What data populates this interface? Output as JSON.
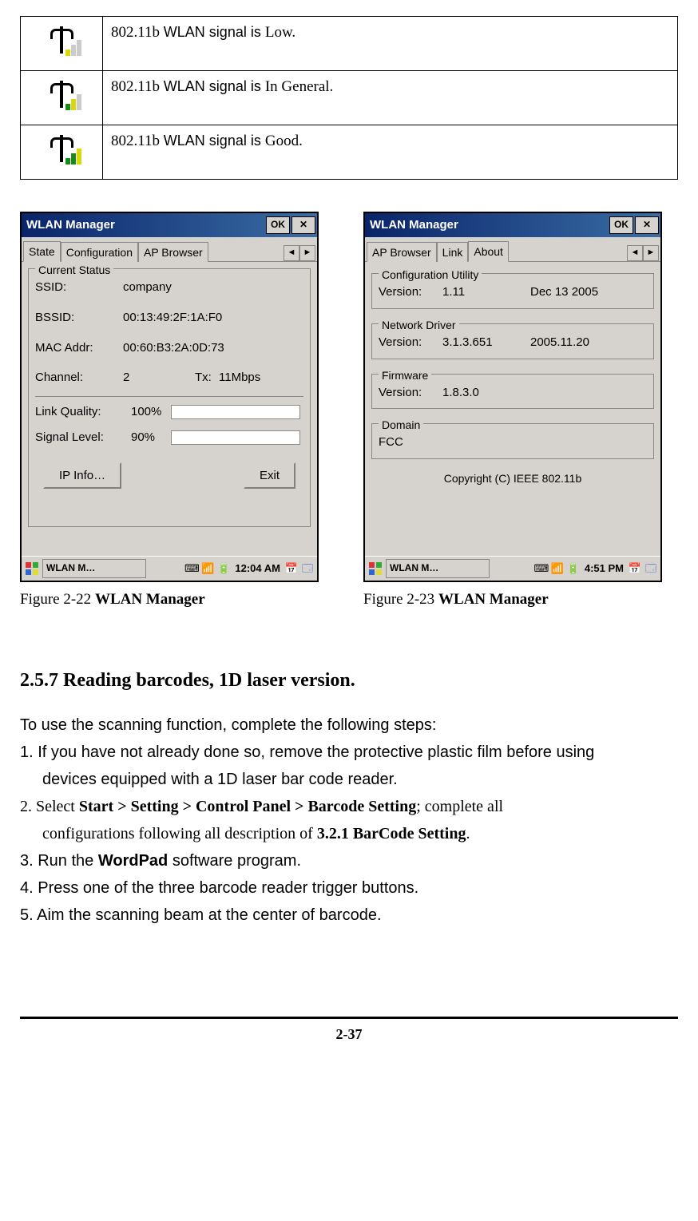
{
  "signal_table": {
    "rows": [
      {
        "prefix": "802.11b ",
        "mid": "WLAN signal is ",
        "suffix": "Low.",
        "bars_on": 1
      },
      {
        "prefix": "802.11b ",
        "mid": "WLAN signal is ",
        "suffix": "In General.",
        "bars_on": 2
      },
      {
        "prefix": "802.11b ",
        "mid": "WLAN signal is ",
        "suffix": "Good.",
        "bars_on": 3
      }
    ]
  },
  "left_window": {
    "title": "WLAN Manager",
    "ok": "OK",
    "close": "✕",
    "tabs": [
      "State",
      "Configuration",
      "AP Browser"
    ],
    "active_tab_index": 0,
    "group_legend": "Current Status",
    "fields": {
      "ssid_label": "SSID:",
      "ssid_value": "company",
      "bssid_label": "BSSID:",
      "bssid_value": "00:13:49:2F:1A:F0",
      "mac_label": "MAC Addr:",
      "mac_value": "00:60:B3:2A:0D:73",
      "channel_label": "Channel:",
      "channel_value": "2",
      "tx_label": "Tx:",
      "tx_value": "11Mbps",
      "linkq_label": "Link Quality:",
      "linkq_value": "100%",
      "linkq_percent": 100,
      "siglvl_label": "Signal Level:",
      "siglvl_value": "90%",
      "siglvl_percent": 90
    },
    "buttons": {
      "ipinfo": "IP Info…",
      "exit": "Exit"
    },
    "taskbar": {
      "task": "WLAN M…",
      "time": "12:04 AM"
    }
  },
  "right_window": {
    "title": "WLAN Manager",
    "ok": "OK",
    "close": "✕",
    "tabs": [
      "AP Browser",
      "Link",
      "About"
    ],
    "active_tab_index": 2,
    "groups": {
      "config_util": {
        "legend": "Configuration Utility",
        "version_label": "Version:",
        "version_value": "1.11",
        "date_value": "Dec 13 2005"
      },
      "net_driver": {
        "legend": "Network Driver",
        "version_label": "Version:",
        "version_value": "3.1.3.651",
        "date_value": "2005.11.20"
      },
      "firmware": {
        "legend": "Firmware",
        "version_label": "Version:",
        "version_value": "1.8.3.0"
      },
      "domain": {
        "legend": "Domain",
        "value": "FCC"
      }
    },
    "copyright": "Copyright (C)  IEEE  802.11b",
    "taskbar": {
      "task": "WLAN M…",
      "time": "4:51 PM"
    }
  },
  "captions": {
    "left_prefix": "Figure 2-22 ",
    "left_bold": "WLAN Manager",
    "right_prefix": "Figure 2-23 ",
    "right_bold": "WLAN Manager"
  },
  "section_heading": "2.5.7 Reading barcodes, 1D laser version.",
  "body": {
    "intro": "To use the scanning function, complete the following steps:",
    "step1a": "1. If you have not already done so, remove the protective plastic film before using",
    "step1b": "devices equipped with a 1D laser bar code reader.",
    "step2a_prefix": "2. ",
    "step2a_serif1": "Select ",
    "step2a_bold": "Start > Setting > Control Panel > Barcode Setting",
    "step2a_serif2": "; complete all",
    "step2b_serif1": "configurations following all description of ",
    "step2b_bold": "3.2.1 BarCode Setting",
    "step2b_serif2": ".",
    "step3_prefix": "3. Run the ",
    "step3_bold": "WordPad",
    "step3_suffix": " software program.",
    "step4": "4. Press one of the three barcode reader trigger buttons.",
    "step5": "5. Aim the scanning beam at the center of barcode."
  },
  "page_number": "2-37"
}
